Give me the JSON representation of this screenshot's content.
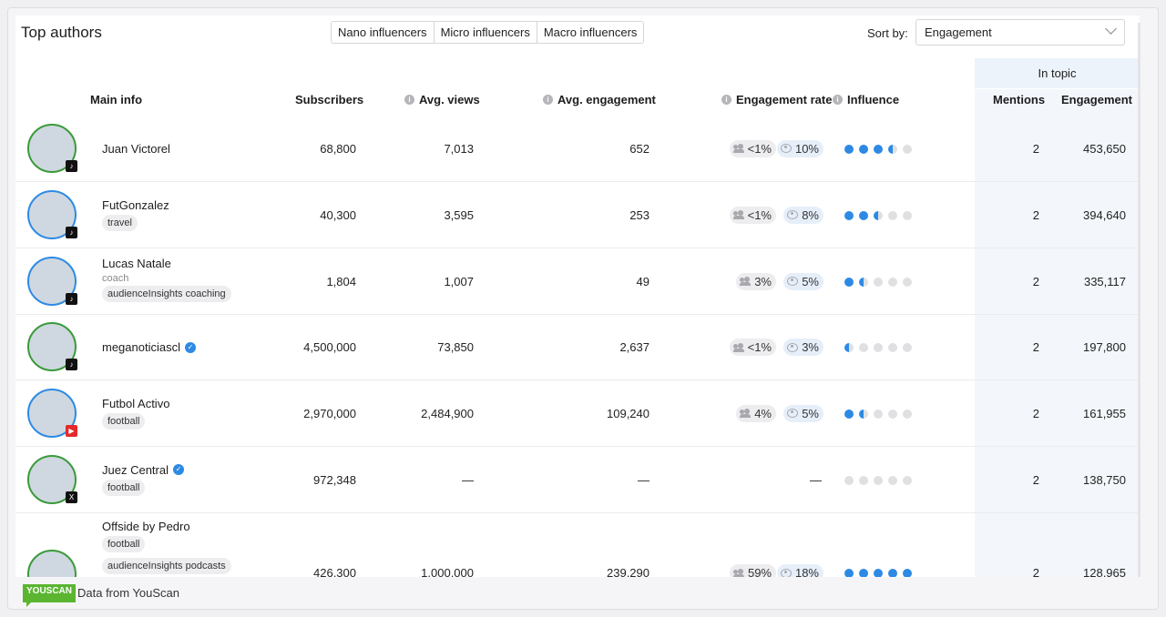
{
  "header": {
    "title": "Top authors",
    "segments": [
      "Nano influencers",
      "Micro influencers",
      "Macro influencers"
    ],
    "sort_label": "Sort by:",
    "sort_value": "Engagement"
  },
  "columns": {
    "main_info": "Main info",
    "subscribers": "Subscribers",
    "avg_views": "Avg. views",
    "avg_engagement": "Avg. engagement",
    "engagement_rate": "Engagement rate",
    "influence": "Influence",
    "in_topic": "In topic",
    "mentions": "Mentions",
    "engagement": "Engagement"
  },
  "rows": [
    {
      "name": "Juan Victorel",
      "verified": false,
      "subtitle": "",
      "tags": [],
      "platform": "tiktok",
      "subscribers": "68,800",
      "avg_views": "7,013",
      "avg_engagement": "652",
      "rate_audience": "<1%",
      "rate_views": "10%",
      "influence": 3.5,
      "mentions": "2",
      "engagement": "453,650",
      "avatar_color": "#3a9a3a"
    },
    {
      "name": "FutGonzalez",
      "verified": false,
      "subtitle": "",
      "tags": [
        "travel"
      ],
      "platform": "tiktok",
      "subscribers": "40,300",
      "avg_views": "3,595",
      "avg_engagement": "253",
      "rate_audience": "<1%",
      "rate_views": "8%",
      "influence": 2.5,
      "mentions": "2",
      "engagement": "394,640",
      "avatar_color": "#2d8ae4"
    },
    {
      "name": "Lucas Natale",
      "verified": false,
      "subtitle": "coach",
      "tags": [
        "audienceInsights coaching"
      ],
      "platform": "tiktok",
      "subscribers": "1,804",
      "avg_views": "1,007",
      "avg_engagement": "49",
      "rate_audience": "3%",
      "rate_views": "5%",
      "influence": 1.5,
      "mentions": "2",
      "engagement": "335,117",
      "avatar_color": "#2d8ae4"
    },
    {
      "name": "meganoticiascl",
      "verified": true,
      "subtitle": "",
      "tags": [],
      "platform": "tiktok",
      "subscribers": "4,500,000",
      "avg_views": "73,850",
      "avg_engagement": "2,637",
      "rate_audience": "<1%",
      "rate_views": "3%",
      "influence": 0.5,
      "mentions": "2",
      "engagement": "197,800",
      "avatar_color": "#3a9a3a"
    },
    {
      "name": "Futbol Activo",
      "verified": false,
      "subtitle": "",
      "tags": [
        "football"
      ],
      "platform": "youtube",
      "subscribers": "2,970,000",
      "avg_views": "2,484,900",
      "avg_engagement": "109,240",
      "rate_audience": "4%",
      "rate_views": "5%",
      "influence": 1.5,
      "mentions": "2",
      "engagement": "161,955",
      "avatar_color": "#2d8ae4"
    },
    {
      "name": "Juez Central",
      "verified": true,
      "subtitle": "",
      "tags": [
        "football"
      ],
      "platform": "x",
      "subscribers": "972,348",
      "avg_views": "—",
      "avg_engagement": "—",
      "rate_audience": "",
      "rate_views": "",
      "rate_dash": "—",
      "influence": 0,
      "mentions": "2",
      "engagement": "138,750",
      "avatar_color": "#3a9a3a"
    },
    {
      "name": "Offside by Pedro",
      "verified": false,
      "subtitle": "",
      "tags": [
        "football",
        "audienceInsights podcasts"
      ],
      "platform": "tiktok",
      "subscribers": "426,300",
      "avg_views": "1,000,000",
      "avg_engagement": "239,290",
      "rate_audience": "59%",
      "rate_views": "18%",
      "influence": 5,
      "mentions": "2",
      "engagement": "128,965",
      "avatar_color": "#3a9a3a"
    }
  ],
  "footer": {
    "logo_text": "YOUSCAN",
    "source_text": "Data from YouScan"
  }
}
